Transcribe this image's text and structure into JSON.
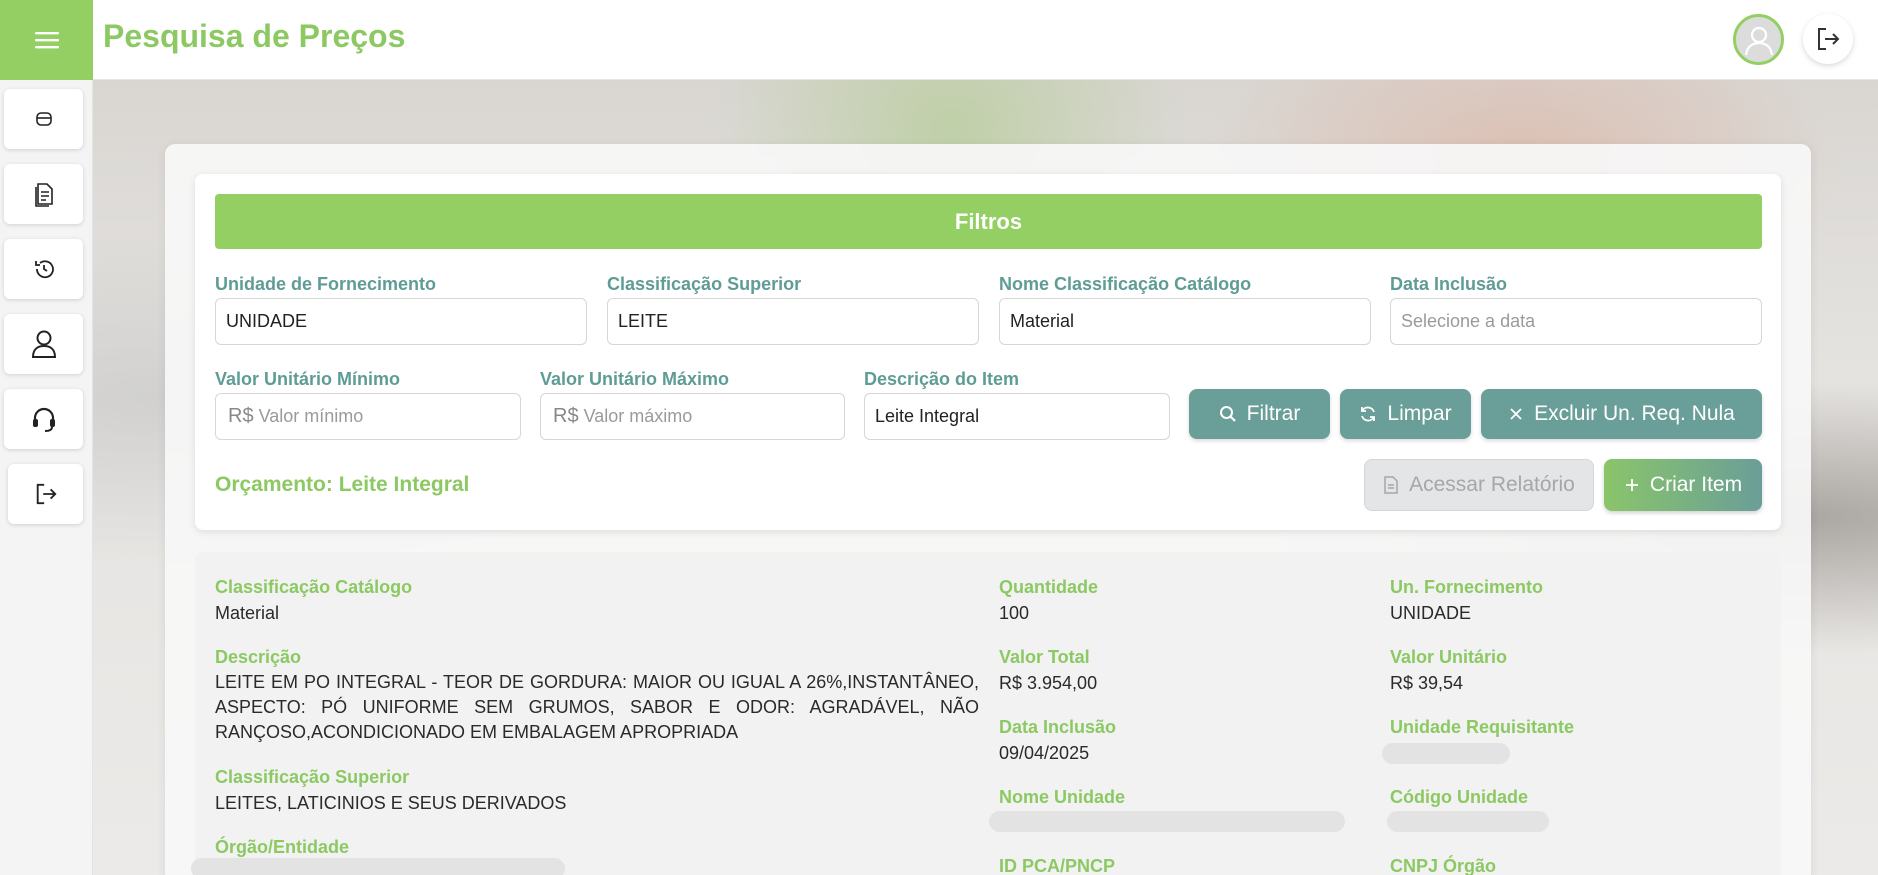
{
  "app": {
    "title": "Pesquisa de Preços"
  },
  "header": {
    "menu_icon": "hamburger-menu-icon",
    "avatar_icon": "user-avatar-icon",
    "logout_icon": "logout-icon"
  },
  "sidebar": {
    "items": [
      {
        "name": "database-icon"
      },
      {
        "name": "document-list-icon"
      },
      {
        "name": "history-icon"
      },
      {
        "name": "user-icon"
      },
      {
        "name": "headset-icon"
      },
      {
        "name": "logout-icon"
      }
    ]
  },
  "filters": {
    "title": "Filtros",
    "unidade_fornecimento": {
      "label": "Unidade de Fornecimento",
      "value": "UNIDADE"
    },
    "classificacao_superior": {
      "label": "Classificação Superior",
      "value": "LEITE"
    },
    "nome_classificacao": {
      "label": "Nome Classificação Catálogo",
      "value": "Material"
    },
    "data_inclusao": {
      "label": "Data Inclusão",
      "placeholder": "Selecione a data"
    },
    "valor_minimo": {
      "label": "Valor Unitário Mínimo",
      "prefix": "R$",
      "placeholder": "Valor mínimo"
    },
    "valor_maximo": {
      "label": "Valor Unitário Máximo",
      "prefix": "R$",
      "placeholder": "Valor máximo"
    },
    "descricao_item": {
      "label": "Descrição do Item",
      "value": "Leite Integral"
    },
    "buttons": {
      "filtrar": "Filtrar",
      "limpar": "Limpar",
      "excluir": "Excluir Un. Req. Nula",
      "acessar_relatorio": "Acessar Relatório",
      "criar_item": "Criar Item"
    },
    "orcamento": "Orçamento: Leite Integral"
  },
  "item": {
    "classificacao_catalogo": {
      "label": "Classificação Catálogo",
      "value": "Material"
    },
    "descricao": {
      "label": "Descrição",
      "value": "LEITE EM PO INTEGRAL - TEOR DE GORDURA: MAIOR OU IGUAL A 26%,INSTANTÂNEO, ASPECTO: PÓ UNIFORME SEM GRUMOS, SABOR E ODOR: AGRADÁVEL, NÃO RANÇOSO,ACONDICIONADO EM EMBALAGEM APROPRIADA"
    },
    "classificacao_superior": {
      "label": "Classificação Superior",
      "value": "LEITES, LATICINIOS E SEUS DERIVADOS"
    },
    "orgao_entidade": {
      "label": "Órgão/Entidade"
    },
    "quantidade": {
      "label": "Quantidade",
      "value": "100"
    },
    "valor_total": {
      "label": "Valor Total",
      "value": "R$ 3.954,00"
    },
    "data_inclusao": {
      "label": "Data Inclusão",
      "value": "09/04/2025"
    },
    "nome_unidade": {
      "label": "Nome Unidade"
    },
    "id_pca_pncp": {
      "label": "ID PCA/PNCP"
    },
    "un_fornecimento": {
      "label": "Un. Fornecimento",
      "value": "UNIDADE"
    },
    "valor_unitario": {
      "label": "Valor Unitário",
      "value": "R$ 39,54"
    },
    "unidade_requisitante": {
      "label": "Unidade Requisitante"
    },
    "codigo_unidade": {
      "label": "Código Unidade"
    },
    "cnpj_orgao": {
      "label": "CNPJ Órgão"
    }
  },
  "colors": {
    "brand_green": "#93cf62",
    "teal_button": "#6a9e98",
    "label_teal": "#5f9c96",
    "label_green": "#8cc963"
  }
}
